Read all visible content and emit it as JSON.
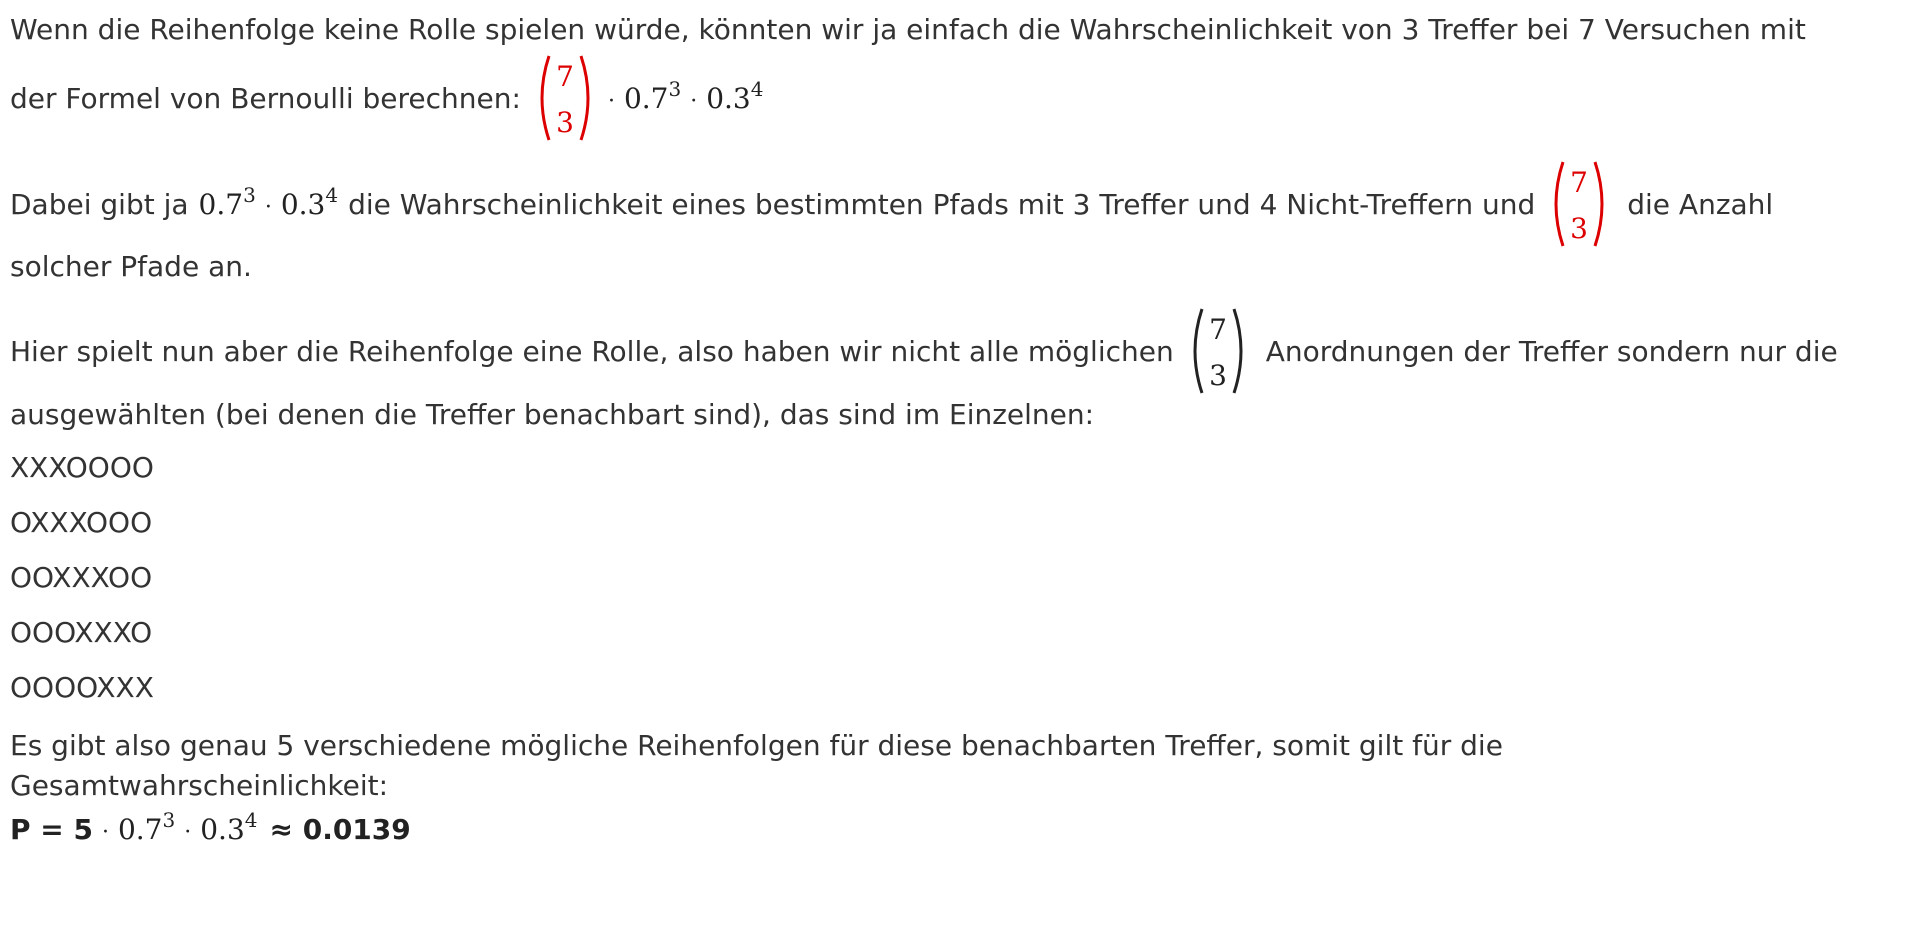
{
  "paragraph1": {
    "line1": "Wenn die Reihenfolge keine Rolle spielen würde, könnten wir ja einfach die Wahrscheinlichkeit von 3 Treffer bei 7 Versuchen mit",
    "line2_prefix": "der Formel von Bernoulli berechnen:"
  },
  "paragraph2": {
    "prefix": "Dabei gibt ja",
    "middle": "die Wahrscheinlichkeit eines bestimmten Pfads mit 3 Treffer und 4 Nicht-Treffern und",
    "suffix": "die Anzahl",
    "line2": "solcher Pfade an."
  },
  "paragraph3": {
    "prefix": "Hier spielt nun aber die Reihenfolge eine Rolle, also haben wir nicht alle möglichen",
    "suffix": "Anordnungen der Treffer sondern nur die",
    "line2": "ausgewählten (bei denen die Treffer benachbart sind), das sind im Einzelnen:"
  },
  "binom": {
    "n": "7",
    "k": "3"
  },
  "term": {
    "base1": "0.7",
    "exp1": "3",
    "base2": "0.3",
    "exp2": "4",
    "dot": "·"
  },
  "paths": [
    "XXXOOOO",
    "OXXXOOO",
    "OOXXXOO",
    "OOOXXXO",
    "OOOOXXX"
  ],
  "conclusion": {
    "line1": "Es gibt also genau 5 verschiedene mögliche Reihenfolgen für diese benachbarten Treffer, somit gilt für die",
    "line2": "Gesamtwahrscheinlichkeit:",
    "result_prefix": "P = 5",
    "result_suffix": "≈ 0.0139"
  },
  "colors": {
    "highlight": "#dd0000",
    "text": "#333333"
  }
}
